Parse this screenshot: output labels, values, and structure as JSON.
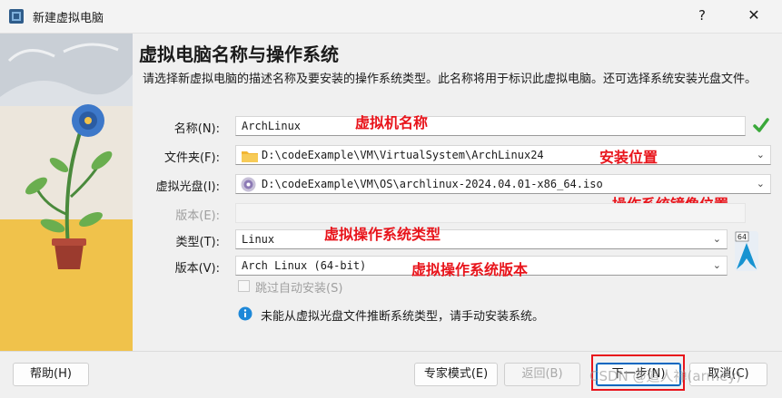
{
  "window": {
    "title": "新建虚拟电脑",
    "help_glyph": "?",
    "close_glyph": "✕"
  },
  "page": {
    "heading": "虚拟电脑名称与操作系统",
    "description": "请选择新虚拟电脑的描述名称及要安装的操作系统类型。此名称将用于标识此虚拟电脑。还可选择系统安装光盘文件。"
  },
  "form": {
    "name_label": "名称(N):",
    "name_value": "ArchLinux",
    "folder_label": "文件夹(F):",
    "folder_value": "D:\\codeExample\\VM\\VirtualSystem\\ArchLinux24",
    "iso_label": "虚拟光盘(I):",
    "iso_value": "D:\\codeExample\\VM\\OS\\archlinux-2024.04.01-x86_64.iso",
    "edition_label": "版本(E):",
    "edition_value": "",
    "type_label": "类型(T):",
    "type_value": "Linux",
    "version_label": "版本(V):",
    "version_value": "Arch Linux (64-bit)",
    "unattended_label": "跳过自动安装(S)",
    "info_text": "未能从虚拟光盘文件推断系统类型，请手动安装系统。",
    "os_badge_text": "64"
  },
  "annotations": {
    "name": "虚拟机名称",
    "folder": "安装位置",
    "iso": "操作系统镜像位置",
    "type": "虚拟操作系统类型",
    "version": "虚拟操作系统版本"
  },
  "buttons": {
    "help": "帮助(H)",
    "expert": "专家模式(E)",
    "back": "返回(B)",
    "next": "下一步(N)",
    "cancel": "取消(C)"
  },
  "watermark": "CSDN @道人禅(armey)",
  "colors": {
    "annotation_red": "#e8141b",
    "accent_blue": "#0067c0",
    "check_green": "#3aa83a"
  }
}
